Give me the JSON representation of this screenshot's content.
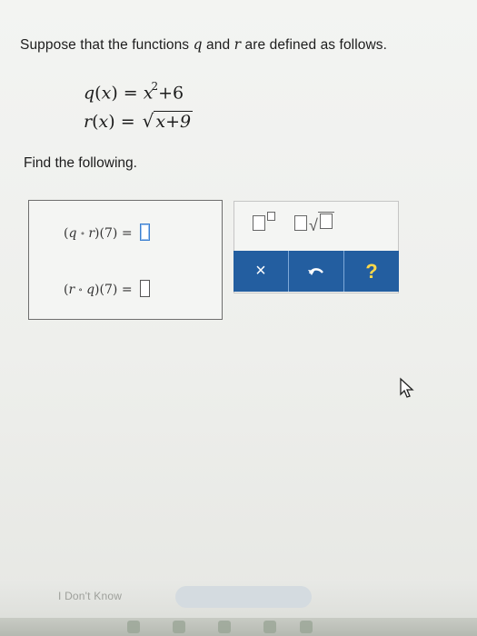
{
  "problem": {
    "statement_parts": [
      "Suppose that the functions ",
      "q",
      " and ",
      "r",
      " are defined as follows."
    ],
    "q_def": {
      "name": "q",
      "var": "x",
      "lhs_close": ")",
      "eq": "=",
      "base": "x",
      "exponent": "2",
      "tail": "+6"
    },
    "r_def": {
      "name": "r",
      "var": "x",
      "lhs_close": ")",
      "eq": "=",
      "radicand": "x+9"
    },
    "find_label": "Find the following."
  },
  "answers": [
    {
      "outer": "q",
      "inner": "r",
      "arg": "7",
      "value": "",
      "active": true
    },
    {
      "outer": "r",
      "inner": "q",
      "arg": "7",
      "value": "",
      "active": false
    }
  ],
  "palette": {
    "templates": [
      "superscript-template-icon",
      "sqrt-template-icon"
    ],
    "buttons": {
      "clear": "×",
      "undo_icon": "undo-icon",
      "help": "?"
    },
    "colors": {
      "toolbar": "#235ea0",
      "help": "#ffd84a"
    }
  },
  "footer": {
    "dont_know": "I Don't Know"
  }
}
